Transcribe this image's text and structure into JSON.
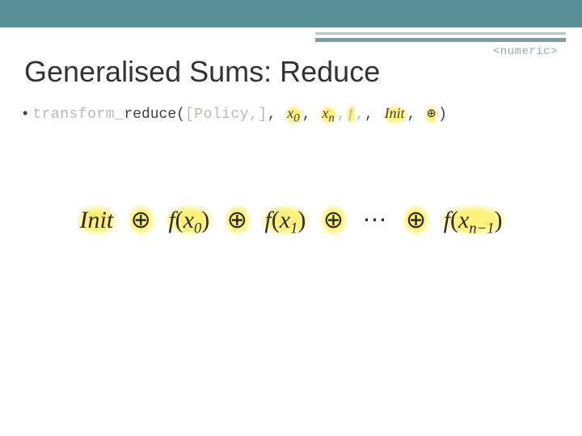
{
  "header": {
    "tag": "<numeric>"
  },
  "title": "Generalised Sums: Reduce",
  "signature": {
    "pre1": "t",
    "pre_ghost": "ransform_",
    "pre2": "reduce(",
    "ghost2": "[Policy,]",
    "comma1": ", ",
    "x0": "x",
    "x0_sub": "0",
    "comma2": ", ",
    "xn": "x",
    "xn_sub": "n",
    "comma3": ",",
    "f": "f",
    "comma_after_f_ghost": ",",
    "comma4": ", ",
    "init": "Init",
    "comma5": ", ",
    "oplus": "⊕",
    "close": ")"
  },
  "formula": {
    "init": "Init",
    "oplus": "⊕",
    "f": "f",
    "x": "x",
    "sub0": "0",
    "sub1": "1",
    "dots": "⋯",
    "subnm1": "n−1"
  }
}
